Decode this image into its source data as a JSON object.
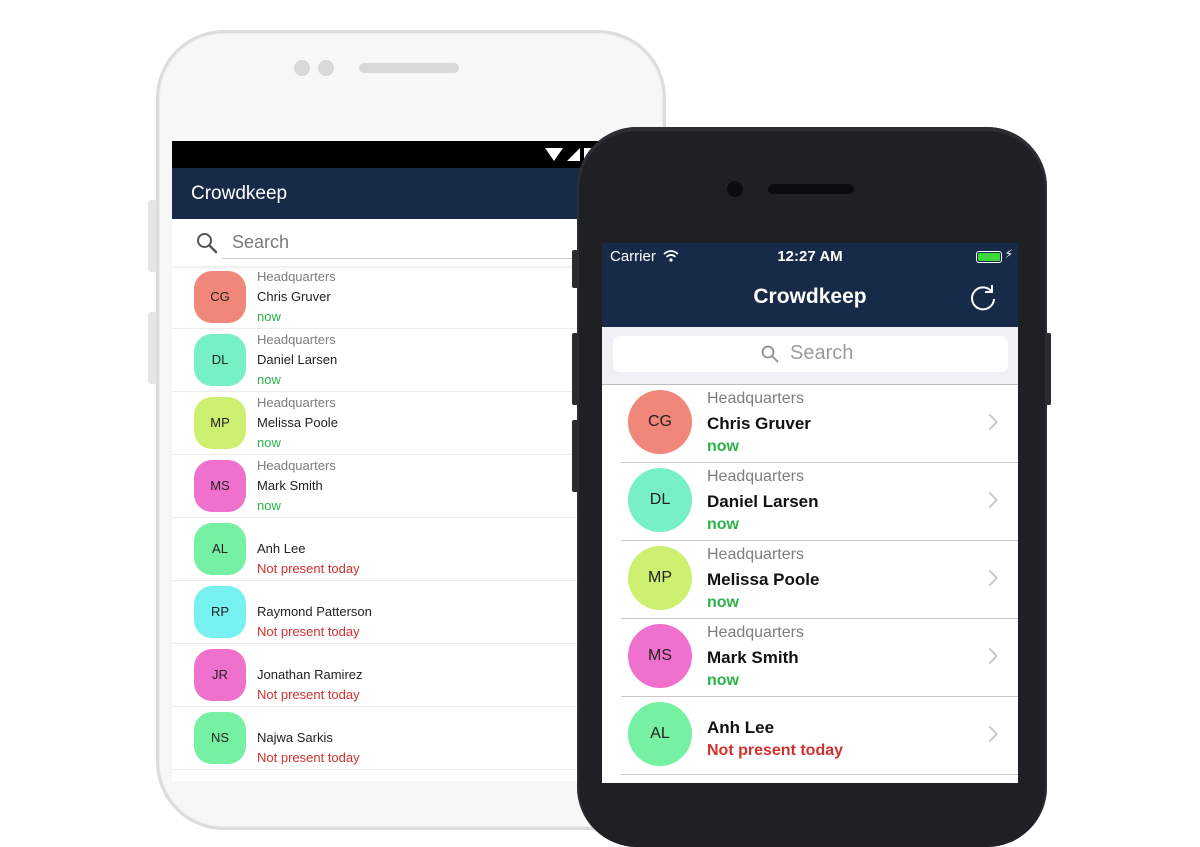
{
  "colors": {
    "appbar": "#172a47",
    "present": "#2ab34a",
    "absent": "#d0312d"
  },
  "android": {
    "app_title": "Crowdkeep",
    "search_placeholder": "Search",
    "contacts": [
      {
        "initials": "CG",
        "location": "Headquarters",
        "name": "Chris Gruver",
        "status": "now",
        "present": true,
        "color": "#f0877a"
      },
      {
        "initials": "DL",
        "location": "Headquarters",
        "name": "Daniel Larsen",
        "status": "now",
        "present": true,
        "color": "#76f0c4"
      },
      {
        "initials": "MP",
        "location": "Headquarters",
        "name": "Melissa Poole",
        "status": "now",
        "present": true,
        "color": "#cef070"
      },
      {
        "initials": "MS",
        "location": "Headquarters",
        "name": "Mark Smith",
        "status": "now",
        "present": true,
        "color": "#f070cd"
      },
      {
        "initials": "AL",
        "location": "",
        "name": "Anh Lee",
        "status": "Not present today",
        "present": false,
        "color": "#76f0a2"
      },
      {
        "initials": "RP",
        "location": "",
        "name": "Raymond Patterson",
        "status": "Not present today",
        "present": false,
        "color": "#76f0f0"
      },
      {
        "initials": "JR",
        "location": "",
        "name": "Jonathan Ramirez",
        "status": "Not present today",
        "present": false,
        "color": "#f070cd"
      },
      {
        "initials": "NS",
        "location": "",
        "name": "Najwa Sarkis",
        "status": "Not present today",
        "present": false,
        "color": "#76f0a2"
      }
    ]
  },
  "ios": {
    "carrier": "Carrier",
    "time": "12:27 AM",
    "app_title": "Crowdkeep",
    "search_placeholder": "Search",
    "contacts": [
      {
        "initials": "CG",
        "location": "Headquarters",
        "name": "Chris Gruver",
        "status": "now",
        "present": true,
        "color": "#f0877a"
      },
      {
        "initials": "DL",
        "location": "Headquarters",
        "name": "Daniel Larsen",
        "status": "now",
        "present": true,
        "color": "#76f0c4"
      },
      {
        "initials": "MP",
        "location": "Headquarters",
        "name": "Melissa Poole",
        "status": "now",
        "present": true,
        "color": "#cef070"
      },
      {
        "initials": "MS",
        "location": "Headquarters",
        "name": "Mark Smith",
        "status": "now",
        "present": true,
        "color": "#f070cd"
      },
      {
        "initials": "AL",
        "location": "",
        "name": "Anh Lee",
        "status": "Not present today",
        "present": false,
        "color": "#76f0a2"
      }
    ]
  }
}
